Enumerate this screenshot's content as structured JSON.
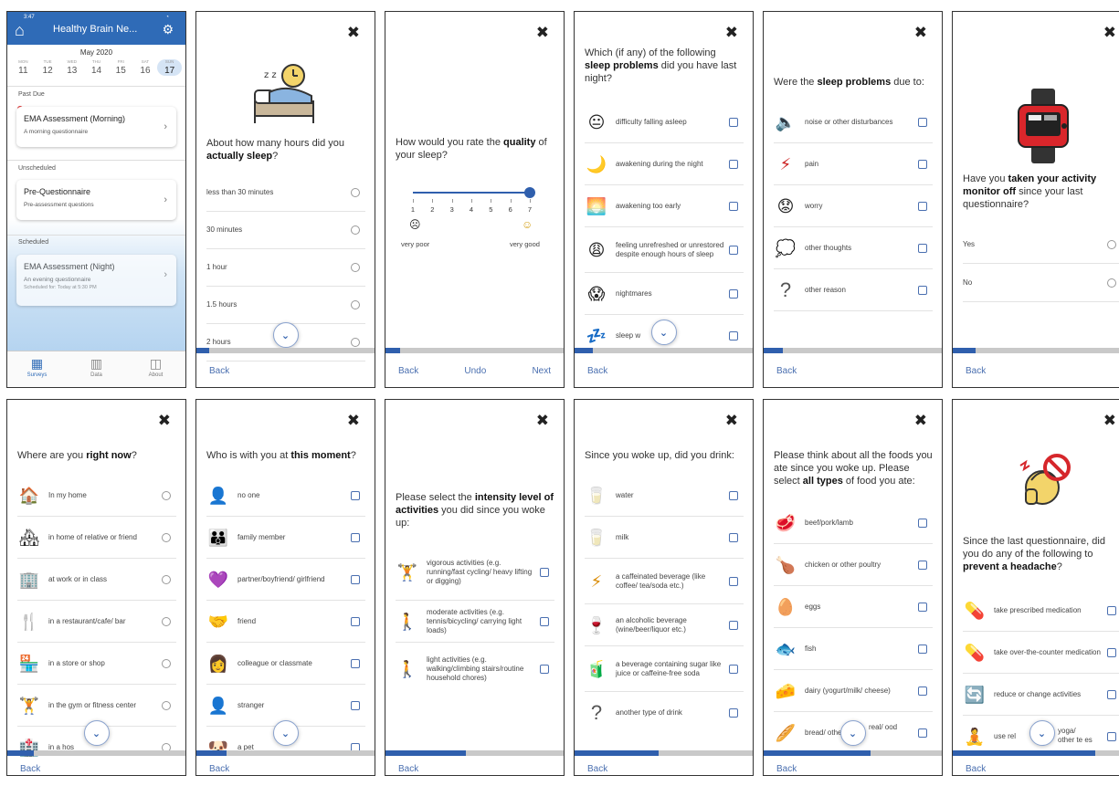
{
  "phone": {
    "time": "3:47",
    "app_title": "Healthy Brain Ne...",
    "month": "May 2020",
    "days": [
      {
        "n": "MON",
        "d": "11"
      },
      {
        "n": "TUE",
        "d": "12"
      },
      {
        "n": "WED",
        "d": "13"
      },
      {
        "n": "THU",
        "d": "14"
      },
      {
        "n": "FRI",
        "d": "15"
      },
      {
        "n": "SAT",
        "d": "16"
      },
      {
        "n": "SUN",
        "d": "17"
      }
    ],
    "past_due": "Past Due",
    "unscheduled": "Unscheduled",
    "scheduled": "Scheduled",
    "card1": {
      "title": "EMA Assessment (Morning)",
      "sub": "A morning questionnaire"
    },
    "card2": {
      "title": "Pre-Questionnaire",
      "sub": "Pre-assessment questions"
    },
    "card3": {
      "title": "EMA Assessment (Night)",
      "sub": "An evening questionnaire",
      "sched": "Scheduled for: Today at 5:30 PM"
    },
    "tabs": [
      "Surveys",
      "Data",
      "About"
    ]
  },
  "common": {
    "back": "Back",
    "undo": "Undo",
    "next": "Next",
    "close": "✖"
  },
  "p_hours": {
    "q_pre": "About how many hours did you ",
    "q_bold": "actually sleep",
    "q_post": "?",
    "options": [
      "less than 30 minutes",
      "30 minutes",
      "1 hour",
      "1.5 hours",
      "2 hours"
    ],
    "progress": 0.07
  },
  "p_quality": {
    "q_pre": "How would you rate the ",
    "q_bold": "quality",
    "q_post": " of your sleep?",
    "ticks": [
      "1",
      "2",
      "3",
      "4",
      "5",
      "6",
      "7"
    ],
    "value": 7,
    "low_label": "very poor",
    "high_label": "very good",
    "progress": 0.08
  },
  "p_problems": {
    "q_pre": "Which (if any) of the following ",
    "q_bold": "sleep problems",
    "q_post": " did you have last night?",
    "options": [
      "difficulty falling asleep",
      "awakening during the night",
      "awakening too early",
      "feeling unrefreshed or unrestored despite enough hours of sleep",
      "nightmares",
      "sleep w"
    ],
    "icons": [
      "😐",
      "🌙",
      "🌅",
      "😩",
      "😱",
      "💤"
    ],
    "progress": 0.1
  },
  "p_due": {
    "q_pre": "Were the ",
    "q_bold": "sleep problems",
    "q_post": " due to:",
    "options": [
      "noise or other disturbances",
      "pain",
      "worry",
      "other thoughts",
      "other reason"
    ],
    "icons": [
      "🔈",
      "⚡",
      "😟",
      "💭",
      "?"
    ],
    "progress": 0.11
  },
  "p_monitor": {
    "q_pre": "Have you ",
    "q_bold": "taken your activity monitor off",
    "q_post": " since your last questionnaire?",
    "options": [
      "Yes",
      "No"
    ],
    "progress": 0.13
  },
  "p_where": {
    "q_pre": "Where are you ",
    "q_bold": "right now",
    "q_post": "?",
    "options": [
      "In my home",
      "in home of relative or friend",
      "at work or in class",
      "in a restaurant/cafe/ bar",
      "in a store or shop",
      "in the gym or fitness center",
      "in a hos"
    ],
    "icons": [
      "🏠",
      "🏘",
      "🏢",
      "🍴",
      "🏪",
      "🏋",
      "🏥"
    ],
    "progress": 0.15
  },
  "p_who": {
    "q_pre": "Who is with you at ",
    "q_bold": "this moment",
    "q_post": "?",
    "options": [
      "no one",
      "family member",
      "partner/boyfriend/ girlfriend",
      "friend",
      "colleague or classmate",
      "stranger",
      "a pet"
    ],
    "icons": [
      "👤",
      "👪",
      "💜",
      "🤝",
      "👩",
      "👤",
      "🐶"
    ],
    "progress": 0.17
  },
  "p_intensity": {
    "q_pre": "Please select the ",
    "q_bold": "intensity level of activities",
    "q_post": " you did since you woke up:",
    "options": [
      "vigorous activities (e.g. running/fast cycling/ heavy lifting or digging)",
      "moderate activities (e.g. tennis/bicycling/ carrying light loads)",
      "light activities (e.g. walking/climbing stairs/routine household chores)"
    ],
    "icons": [
      "🏋",
      "🚶",
      "🚶"
    ],
    "progress": 0.45
  },
  "p_drink": {
    "q_pre": "Since you woke up, did you drink:",
    "q_bold": "",
    "q_post": "",
    "options": [
      "water",
      "milk",
      "a caffeinated beverage (like coffee/ tea/soda etc.)",
      "an alcoholic beverage (wine/beer/liquor etc.)",
      "a beverage containing sugar like juice or caffeine-free soda",
      "another type of drink"
    ],
    "icons": [
      "🥛",
      "🥛",
      "⚡",
      "🍷",
      "🧃",
      "?"
    ],
    "progress": 0.47
  },
  "p_foods": {
    "q_pre": "Please think about all the foods you ate since you woke up. Please select ",
    "q_bold": "all types",
    "q_post": " of food you ate:",
    "options": [
      "beef/pork/lamb",
      "chicken or other poultry",
      "eggs",
      "fish",
      "dairy (yogurt/milk/ cheese)",
      "bread/ other s"
    ],
    "options_tail": [
      "",
      "",
      "",
      "",
      "",
      "real/ ood"
    ],
    "icons": [
      "🥩",
      "🍗",
      "🥚",
      "🐟",
      "🧀",
      "🥖"
    ],
    "progress": 0.6
  },
  "p_headache": {
    "q_pre": "Since the last questionnaire, did you do any of the following to ",
    "q_bold": "prevent a headache",
    "q_post": "?",
    "options": [
      "take prescribed medication",
      "take over-the-counter medication",
      "reduce or change activities",
      "use rel"
    ],
    "options_tail": [
      "",
      "",
      "",
      "yoga/ other te es"
    ],
    "icons": [
      "💊",
      "💊",
      "🔄",
      "🧘"
    ],
    "progress": 0.8
  }
}
